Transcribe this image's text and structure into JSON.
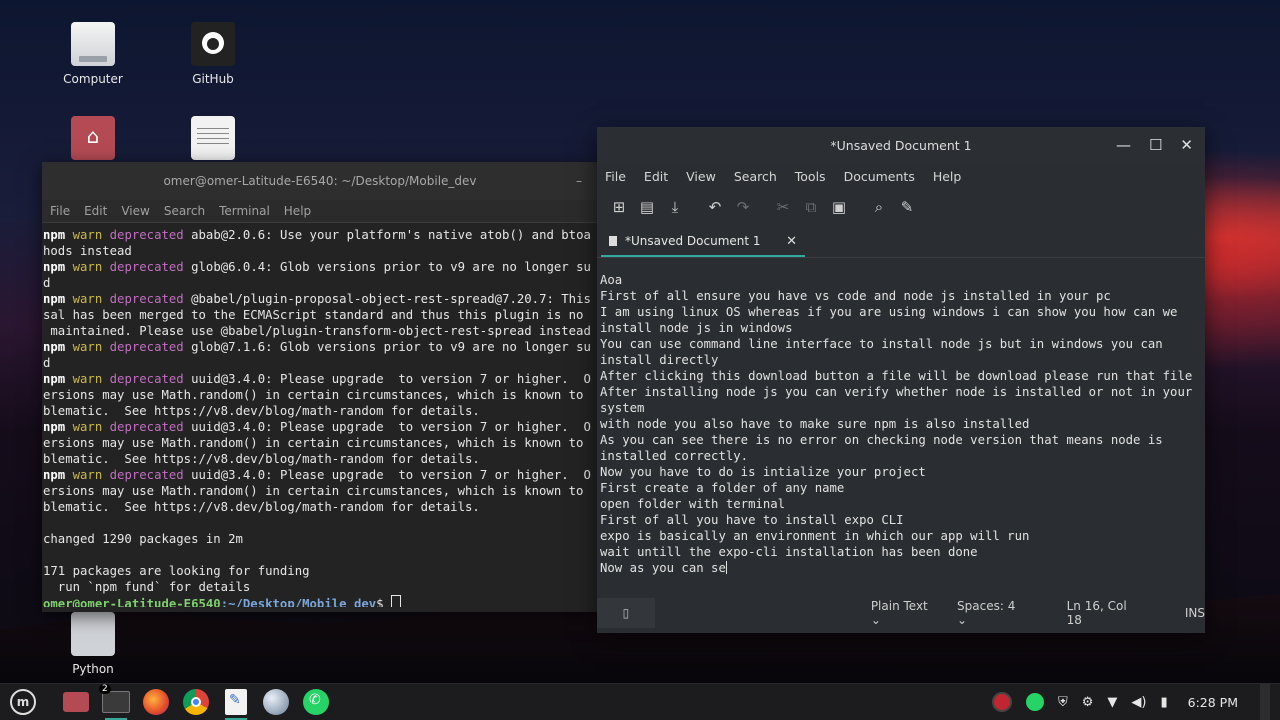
{
  "desktop": {
    "icons": [
      {
        "label": "Computer"
      },
      {
        "label": "GitHub"
      },
      {
        "label": ""
      },
      {
        "label": ""
      },
      {
        "label": "Python"
      }
    ]
  },
  "terminal": {
    "title": "omer@omer-Latitude-E6540: ~/Desktop/Mobile_dev",
    "menu": [
      "File",
      "Edit",
      "View",
      "Search",
      "Terminal",
      "Help"
    ],
    "lines": [
      {
        "kw": "npm",
        "warn": "warn",
        "dep": "deprecated",
        "text": " abab@2.0.6: Use your platform's native atob() and btoa"
      },
      {
        "kw": "",
        "warn": "",
        "dep": "",
        "text": "hods instead"
      },
      {
        "kw": "npm",
        "warn": "warn",
        "dep": "deprecated",
        "text": " glob@6.0.4: Glob versions prior to v9 are no longer su"
      },
      {
        "kw": "",
        "warn": "",
        "dep": "",
        "text": "d"
      },
      {
        "kw": "npm",
        "warn": "warn",
        "dep": "deprecated",
        "text": " @babel/plugin-proposal-object-rest-spread@7.20.7: This"
      },
      {
        "kw": "",
        "warn": "",
        "dep": "",
        "text": "sal has been merged to the ECMAScript standard and thus this plugin is no"
      },
      {
        "kw": "",
        "warn": "",
        "dep": "",
        "text": " maintained. Please use @babel/plugin-transform-object-rest-spread instead"
      },
      {
        "kw": "npm",
        "warn": "warn",
        "dep": "deprecated",
        "text": " glob@7.1.6: Glob versions prior to v9 are no longer su"
      },
      {
        "kw": "",
        "warn": "",
        "dep": "",
        "text": "d"
      },
      {
        "kw": "npm",
        "warn": "warn",
        "dep": "deprecated",
        "text": " uuid@3.4.0: Please upgrade  to version 7 or higher.  O"
      },
      {
        "kw": "",
        "warn": "",
        "dep": "",
        "text": "ersions may use Math.random() in certain circumstances, which is known to"
      },
      {
        "kw": "",
        "warn": "",
        "dep": "",
        "text": "blematic.  See https://v8.dev/blog/math-random for details."
      },
      {
        "kw": "npm",
        "warn": "warn",
        "dep": "deprecated",
        "text": " uuid@3.4.0: Please upgrade  to version 7 or higher.  O"
      },
      {
        "kw": "",
        "warn": "",
        "dep": "",
        "text": "ersions may use Math.random() in certain circumstances, which is known to"
      },
      {
        "kw": "",
        "warn": "",
        "dep": "",
        "text": "blematic.  See https://v8.dev/blog/math-random for details."
      },
      {
        "kw": "npm",
        "warn": "warn",
        "dep": "deprecated",
        "text": " uuid@3.4.0: Please upgrade  to version 7 or higher.  O"
      },
      {
        "kw": "",
        "warn": "",
        "dep": "",
        "text": "ersions may use Math.random() in certain circumstances, which is known to"
      },
      {
        "kw": "",
        "warn": "",
        "dep": "",
        "text": "blematic.  See https://v8.dev/blog/math-random for details."
      },
      {
        "kw": "",
        "warn": "",
        "dep": "",
        "text": ""
      },
      {
        "kw": "",
        "warn": "",
        "dep": "",
        "text": "changed 1290 packages in 2m"
      },
      {
        "kw": "",
        "warn": "",
        "dep": "",
        "text": ""
      },
      {
        "kw": "",
        "warn": "",
        "dep": "",
        "text": "171 packages are looking for funding"
      },
      {
        "kw": "",
        "warn": "",
        "dep": "",
        "text": "  run `npm fund` for details"
      }
    ],
    "prompt_user": "omer@omer-Latitude-E6540",
    "prompt_path": ":~/Desktop/Mobile_dev",
    "prompt_symbol": "$ "
  },
  "editor": {
    "title": "*Unsaved Document 1",
    "menu": [
      "File",
      "Edit",
      "View",
      "Search",
      "Tools",
      "Documents",
      "Help"
    ],
    "tab_label": "*Unsaved Document 1",
    "tab_close": "✕",
    "lines": [
      "Aoa",
      "First of all ensure you have vs code and node js installed in your pc",
      "I am using linux OS whereas if you are using windows i can show you how can we",
      "install node js in windows",
      "You can use command line interface to install node js but in windows you can",
      "install directly",
      "After clicking this download button a file will be download please run that file",
      "After installing node js you can verify whether node is installed or not in your",
      "system",
      "with node you also have to make sure npm is also installed",
      "As you can see there is no error on checking node version that means node is",
      "installed correctly.",
      "Now you have to do is intialize your project",
      "First create a folder of any name",
      "open folder with terminal",
      "First of all you have to install expo CLI",
      "expo is basically an environment in which our app will run",
      "wait untill the expo-cli installation has been done",
      "Now as you can se"
    ],
    "status": {
      "language": "Plain Text",
      "spaces": "Spaces: 4",
      "position": "Ln 16, Col 18",
      "mode": "INS"
    }
  },
  "taskbar": {
    "badge": "2",
    "clock": "6:28 PM"
  }
}
